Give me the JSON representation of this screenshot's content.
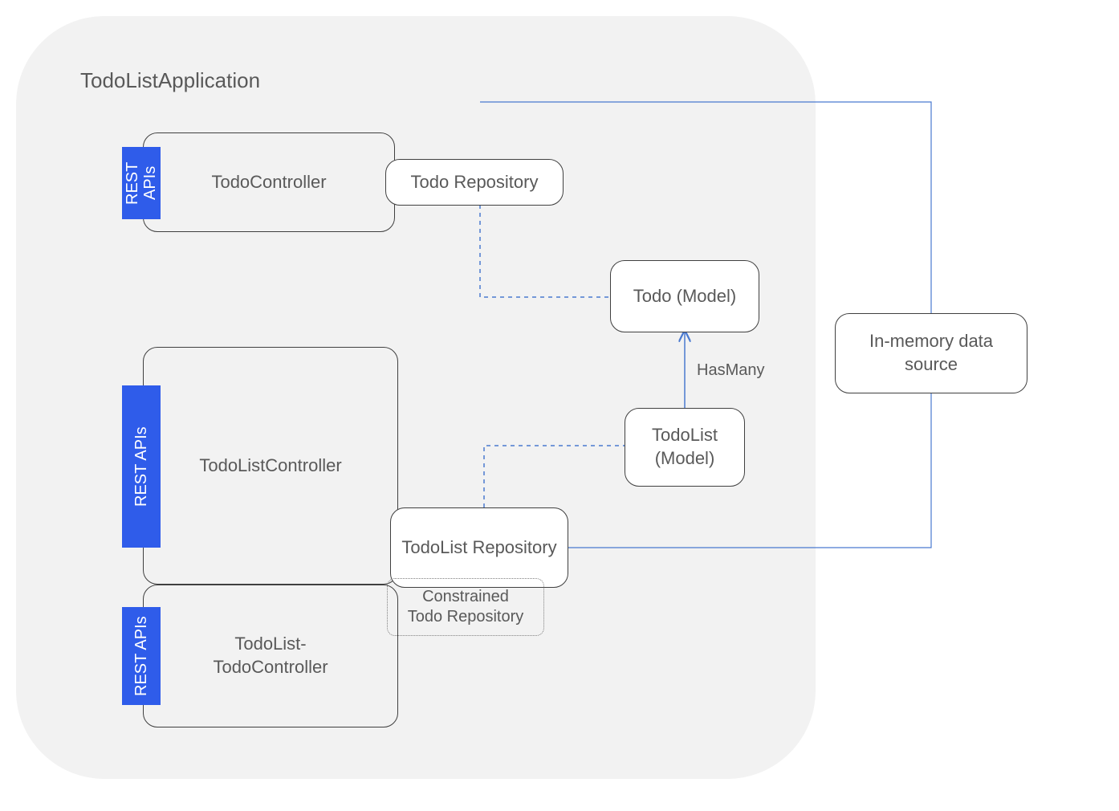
{
  "app_title": "TodoListApplication",
  "badges": {
    "todo": "REST\nAPIs",
    "todolist": "REST APIs",
    "tlcontroller": "REST APIs"
  },
  "nodes": {
    "todo_controller": "TodoController",
    "todo_repo": "Todo Repository",
    "todo_model": "Todo (Model)",
    "todolist_controller": "TodoListController",
    "todolist_repo": "TodoList Repository",
    "todolist_model": "TodoList\n(Model)",
    "tl_todo_controller": "TodoList-\nTodoController",
    "constrained_repo": "Constrained\nTodo Repository",
    "datasource": "In-memory data\nsource"
  },
  "labels": {
    "hasmany": "HasMany"
  },
  "colors": {
    "app_bg": "#f2f2f2",
    "accent": "#2f5cea",
    "line_solid": "#4a7ad0",
    "line_dash": "#4a7ad0",
    "box_border": "#404040",
    "text": "#595959"
  }
}
